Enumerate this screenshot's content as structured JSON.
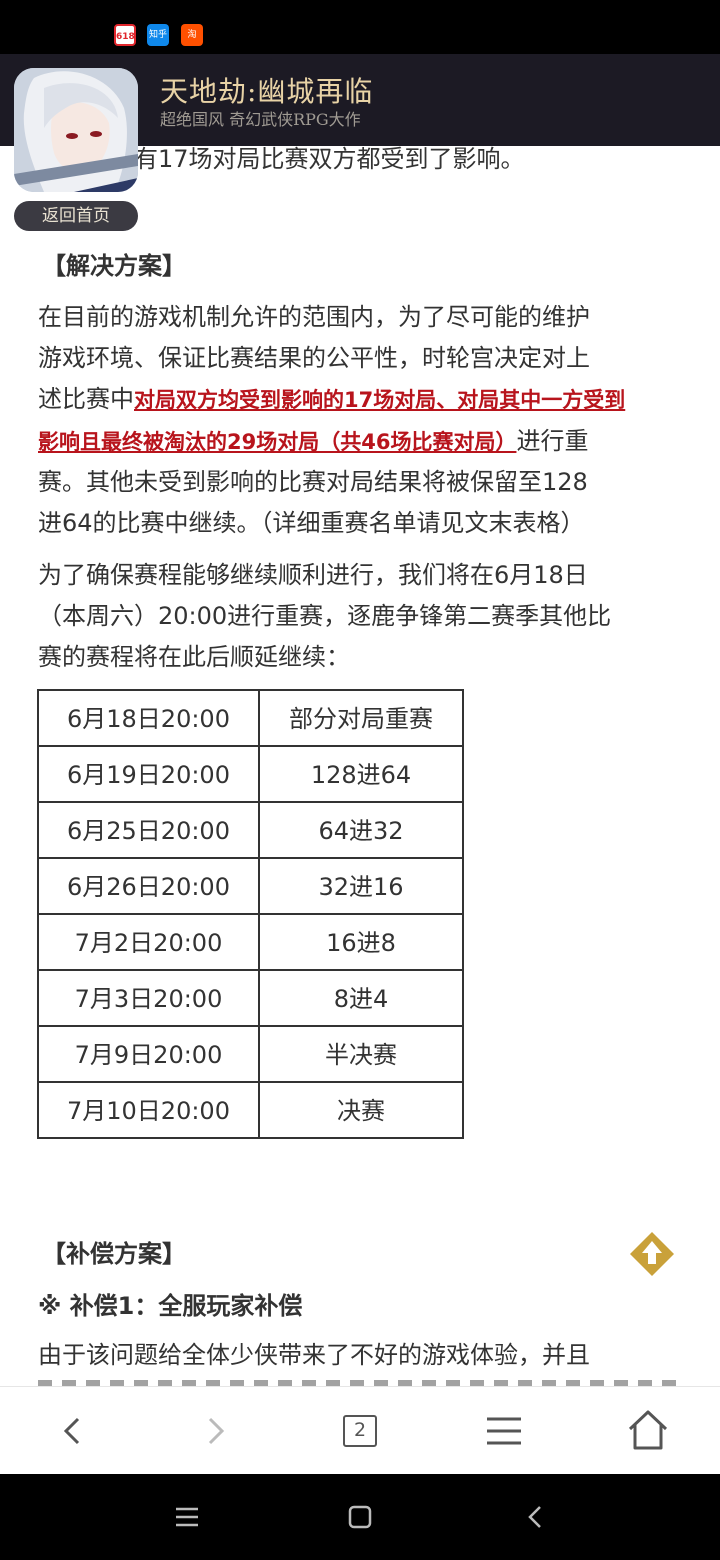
{
  "status_bar": {
    "icons": [
      {
        "name": "618-app-icon",
        "glyph": "618"
      },
      {
        "name": "zhihu-app-icon",
        "glyph": "知乎"
      },
      {
        "name": "taobao-app-icon",
        "glyph": "淘"
      }
    ]
  },
  "banner": {
    "title": "天地劫:幽城再临",
    "subtitle": "超绝国风 奇幻武侠RPG大作",
    "back_label": "返回首页"
  },
  "article": {
    "line0": "致淘汰、有17场对局比赛双方都受到了影响。",
    "solution_heading": "【解决方案】",
    "p1_l1": "在目前的游戏机制允许的范围内，为了尽可能的维护",
    "p1_l2": "游戏环境、保证比赛结果的公平性，时轮宫决定对上",
    "p1_l3_pre": "述比赛中",
    "p1_l3_hl": "对局双方均受到影响的17场对局、对局其中一方受到",
    "p1_l4_hl": "影响且最终被淘汰的29场对局（共46场比赛对局）",
    "p1_l4_post": "进行重",
    "p1_l5": "赛。其他未受到影响的比赛对局结果将被保留至128",
    "p1_l6": "进64的比赛中继续。（详细重赛名单请见文末表格）",
    "p2_l1": "为了确保赛程能够继续顺利进行，我们将在6月18日",
    "p2_l2": "（本周六）20:00进行重赛，逐鹿争锋第二赛季其他比",
    "p2_l3": "赛的赛程将在此后顺延继续：",
    "compensation_heading": "【补偿方案】",
    "comp1_heading": "※ 补偿1：全服玩家补偿",
    "p3_l1": "由于该问题给全体少侠带来了不好的游戏体验，并且"
  },
  "schedule": [
    {
      "time": "6月18日20:00",
      "stage": "部分对局重赛"
    },
    {
      "time": "6月19日20:00",
      "stage": "128进64"
    },
    {
      "time": "6月25日20:00",
      "stage": "64进32"
    },
    {
      "time": "6月26日20:00",
      "stage": "32进16"
    },
    {
      "time": "7月2日20:00",
      "stage": "16进8"
    },
    {
      "time": "7月3日20:00",
      "stage": "8进4"
    },
    {
      "time": "7月9日20:00",
      "stage": "半决赛"
    },
    {
      "time": "7月10日20:00",
      "stage": "决赛"
    }
  ],
  "toolbar": {
    "tab_count": "2"
  },
  "colors": {
    "highlight": "#b8141c",
    "banner_bg": "#1c1a24",
    "banner_title": "#e8d3a6",
    "scroll_top_button": "#c9a13a"
  }
}
